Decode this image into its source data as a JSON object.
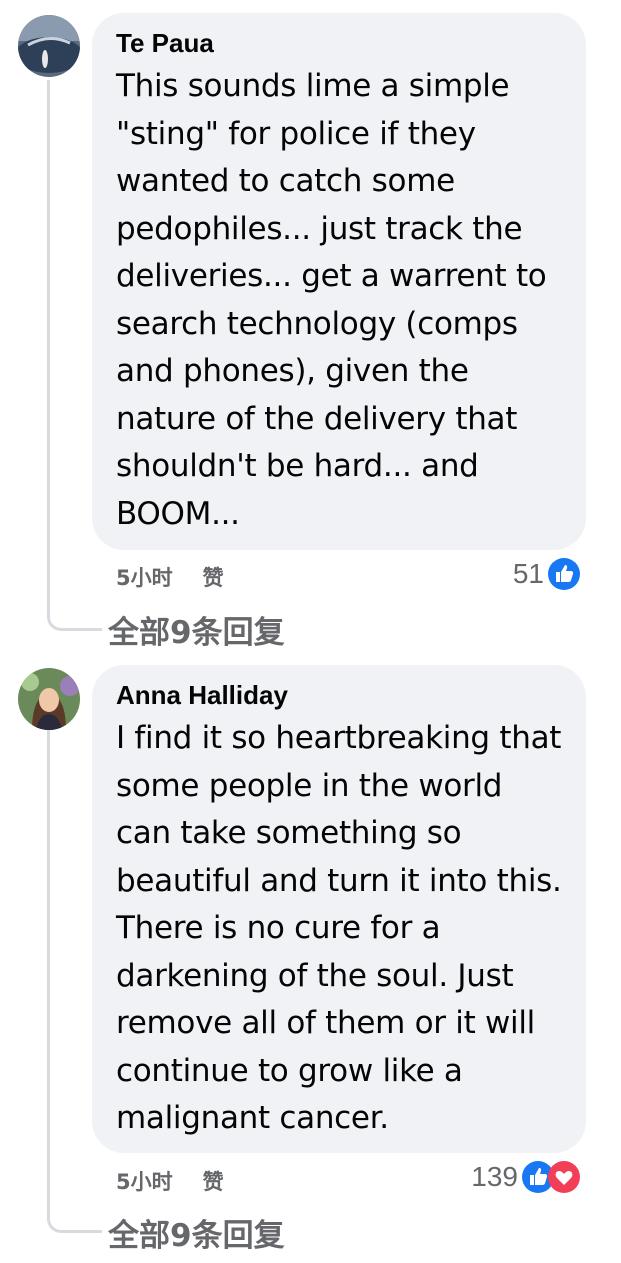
{
  "comments": [
    {
      "author": "Te Paua",
      "text": "This sounds lime a simple \"sting\" for police if they wanted to catch some pedophiles... just track the deliveries... get a warrent to search technology (comps and phones), given the nature of the delivery that shouldn't be hard... and BOOM...",
      "time": "5小时",
      "like_label": "赞",
      "reaction_count": "51",
      "reactions": [
        "like-icon"
      ],
      "replies_label": "全部9条回复"
    },
    {
      "author": "Anna Halliday",
      "text": "I find it so heartbreaking that some people in the world can take something so beautiful and turn it into this. There is no cure for a darkening of the soul. Just remove all of them or it will continue to grow like a malignant cancer.",
      "time": "5小时",
      "like_label": "赞",
      "reaction_count": "139",
      "reactions": [
        "like-icon",
        "love-icon"
      ],
      "replies_label": "全部9条回复"
    }
  ],
  "colors": {
    "bubble": "#f0f2f5",
    "secondary_text": "#65676b",
    "like_blue": "#1877f2",
    "love_red": "#f33e58"
  }
}
